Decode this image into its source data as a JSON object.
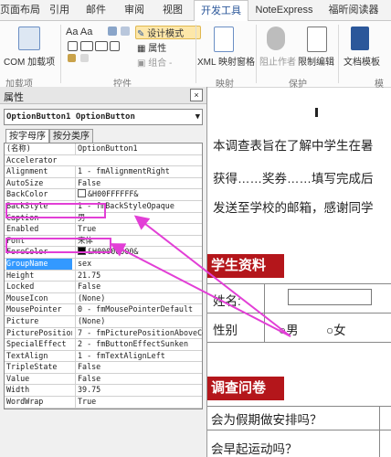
{
  "ribbon": {
    "tabs": [
      "页面布局",
      "引用",
      "邮件",
      "审阅",
      "视图",
      "开发工具",
      "NoteExpress",
      "福昕阅读器"
    ],
    "active_tab": "开发工具",
    "com_addins": "COM 加载项",
    "addins_group": "加载项",
    "design_mode": "设计模式",
    "properties": "属性",
    "group": "组合 -",
    "controls_group": "控件",
    "xml_mapping": "XML 映射窗格",
    "mapping_group": "映射",
    "block_authors": "阻止作者",
    "restrict_editing": "限制编辑",
    "protect_group": "保护",
    "doc_template": "文档模板",
    "template_group": "模板"
  },
  "properties_window": {
    "title": "属性",
    "object_selector": "OptionButton1 OptionButton",
    "tab_alpha": "按字母序",
    "tab_category": "按分类序",
    "rows": [
      {
        "name": "(名称)",
        "value": "OptionButton1"
      },
      {
        "name": "Accelerator",
        "value": ""
      },
      {
        "name": "Alignment",
        "value": "1 - fmAlignmentRight"
      },
      {
        "name": "AutoSize",
        "value": "False"
      },
      {
        "name": "BackColor",
        "value": "&H00FFFFFF&"
      },
      {
        "name": "BackStyle",
        "value": "1 - fmBackStyleOpaque"
      },
      {
        "name": "Caption",
        "value": "男"
      },
      {
        "name": "Enabled",
        "value": "True"
      },
      {
        "name": "Font",
        "value": "宋体"
      },
      {
        "name": "ForeColor",
        "value": "&H00000000&"
      },
      {
        "name": "GroupName",
        "value": "sex"
      },
      {
        "name": "Height",
        "value": "21.75"
      },
      {
        "name": "Locked",
        "value": "False"
      },
      {
        "name": "MouseIcon",
        "value": "(None)"
      },
      {
        "name": "MousePointer",
        "value": "0 - fmMousePointerDefault"
      },
      {
        "name": "Picture",
        "value": "(None)"
      },
      {
        "name": "PicturePosition",
        "value": "7 - fmPicturePositionAboveCe"
      },
      {
        "name": "SpecialEffect",
        "value": "2 - fmButtonEffectSunken"
      },
      {
        "name": "TextAlign",
        "value": "1 - fmTextAlignLeft"
      },
      {
        "name": "TripleState",
        "value": "False"
      },
      {
        "name": "Value",
        "value": "False"
      },
      {
        "name": "Width",
        "value": "39.75"
      },
      {
        "name": "WordWrap",
        "value": "True"
      }
    ]
  },
  "document": {
    "intro_1": "本调查表旨在了解中学生在暑",
    "intro_2": "获得……奖券……填写完成后",
    "intro_3": "发送至学校的邮箱，感谢同学",
    "section_1": "学生资料",
    "name_label": "姓名:",
    "gender_label": "性别",
    "male": "男",
    "female": "女",
    "section_2": "调查问卷",
    "q1": "会为假期做安排吗？",
    "q2": "会早起运动吗？"
  },
  "colors": {
    "banner": "#b4161b",
    "annotation": "#e23fd6",
    "selected": "#3399ff"
  }
}
